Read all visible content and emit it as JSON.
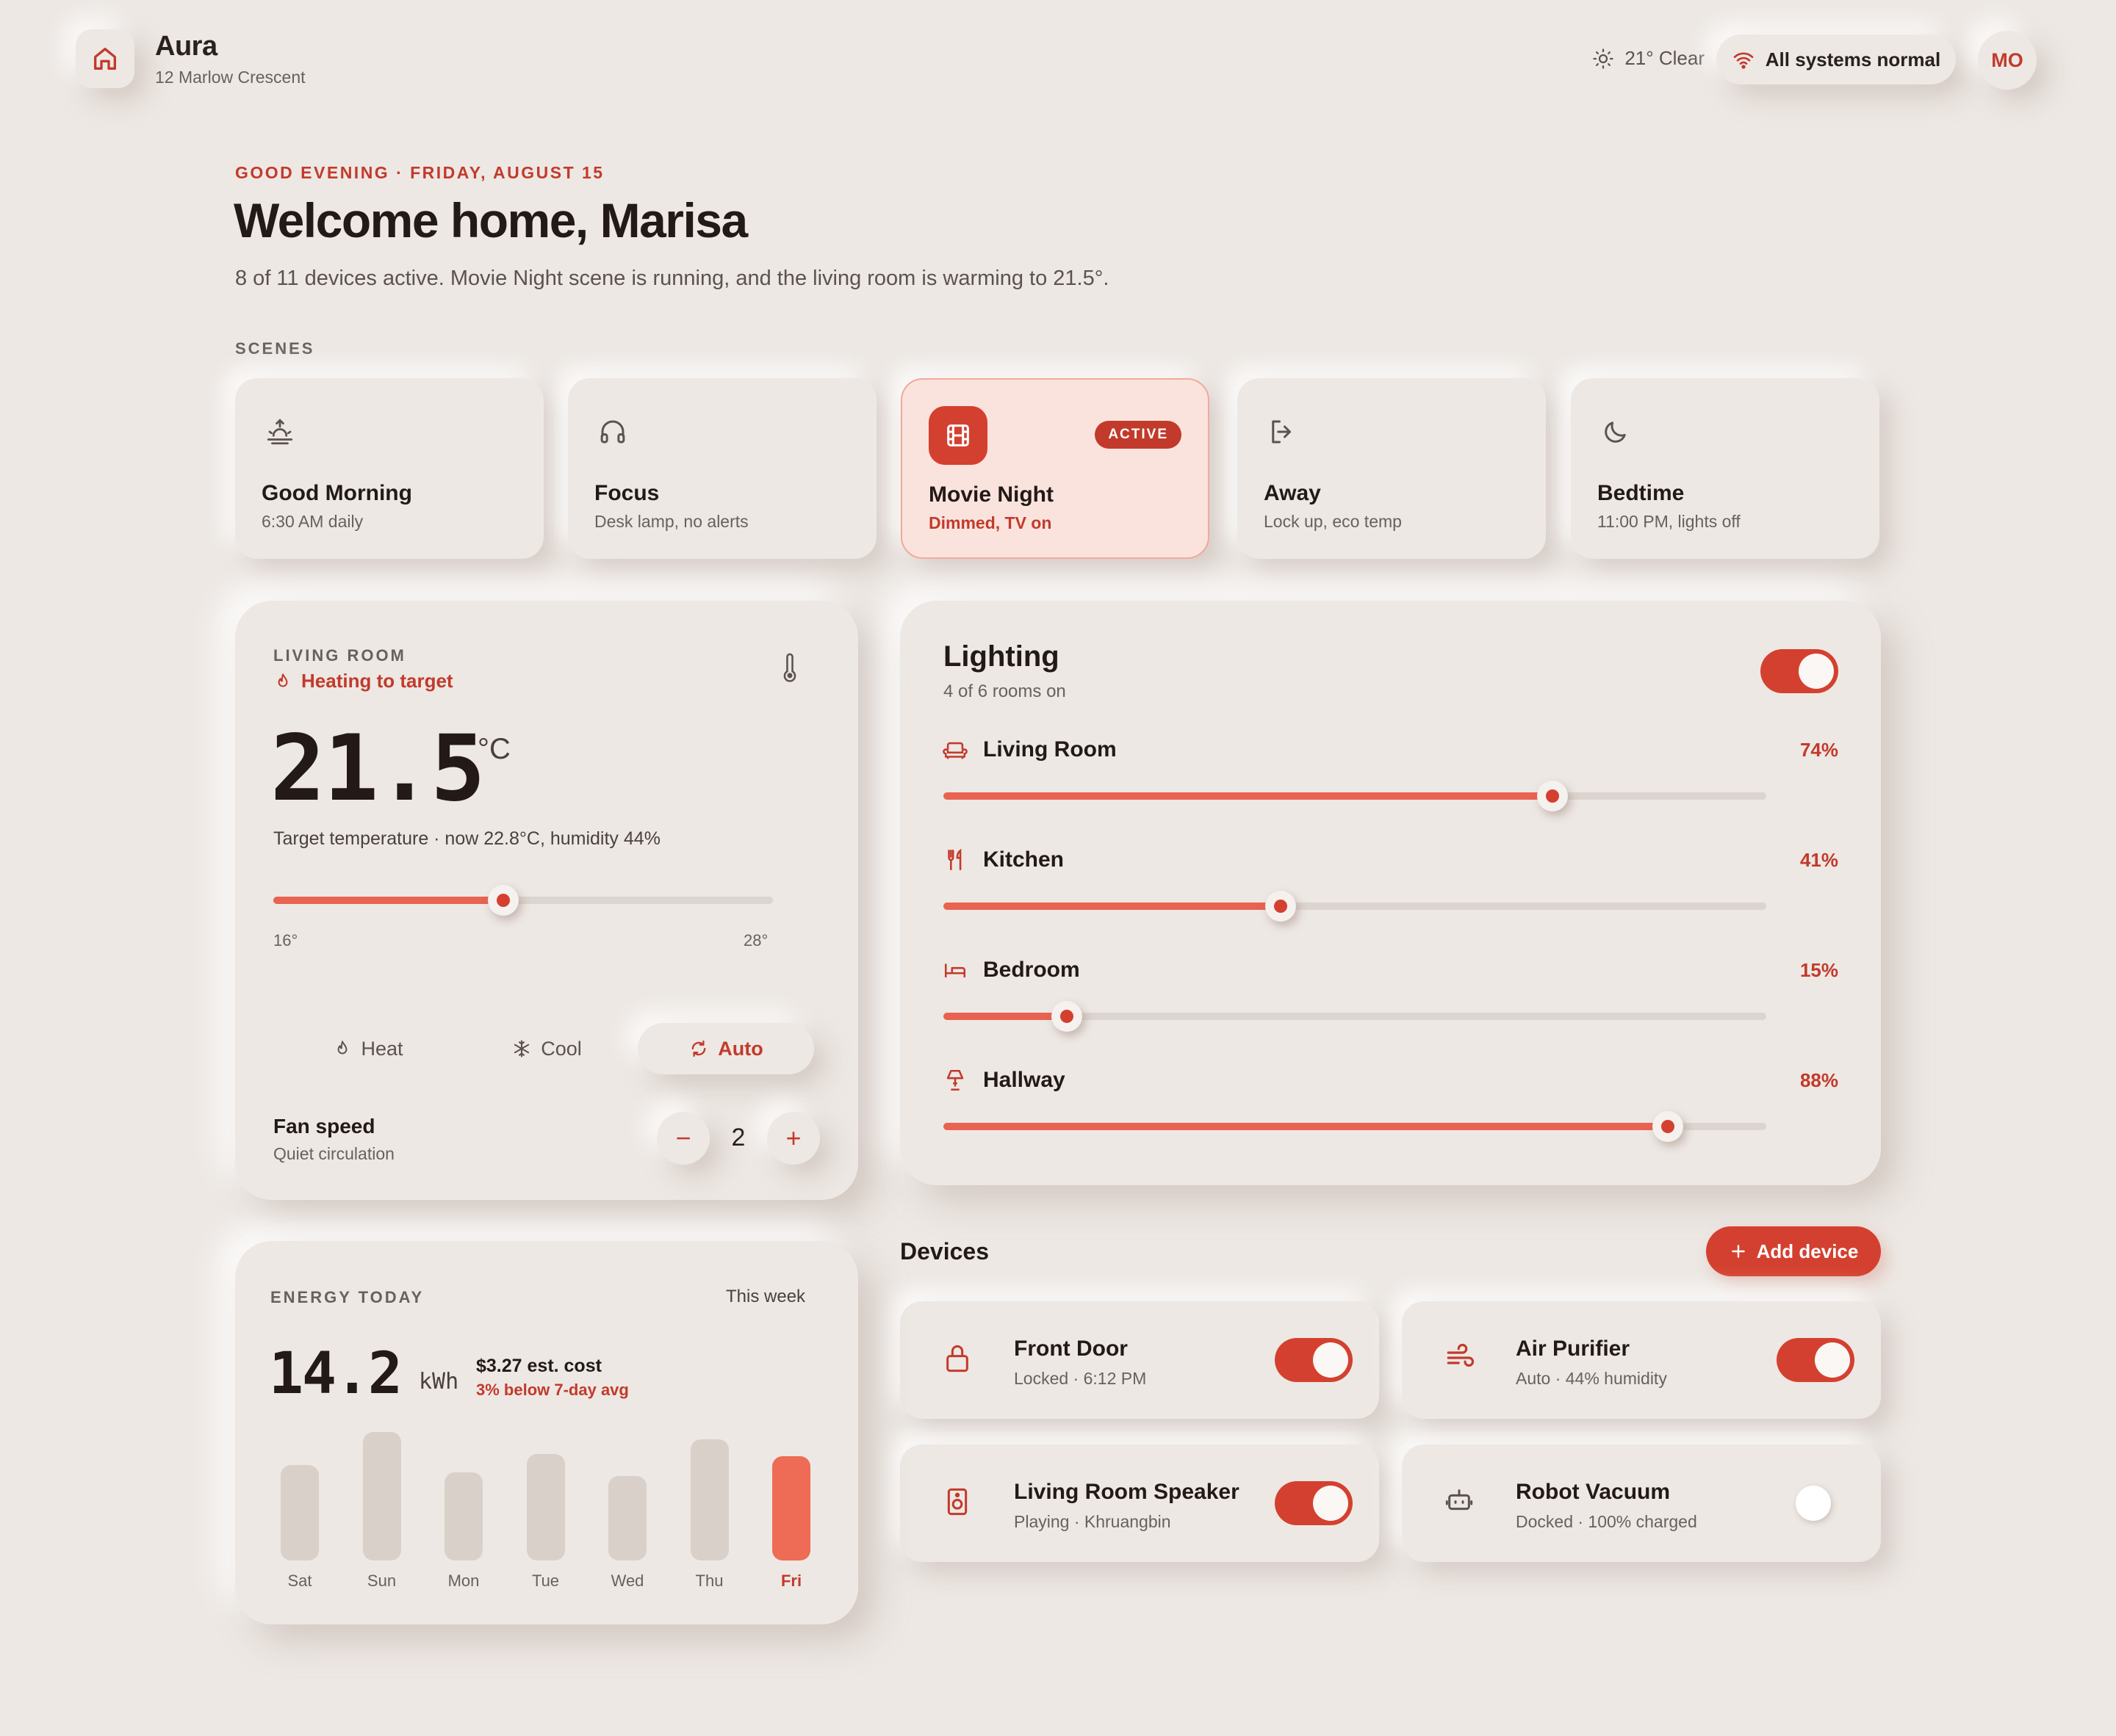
{
  "header": {
    "brand": "Aura",
    "address": "12 Marlow Crescent",
    "weather": "21° Clear",
    "status": "All systems normal",
    "avatar_initials": "MO"
  },
  "hero": {
    "greeting": "GOOD EVENING · FRIDAY, AUGUST 15",
    "title": "Welcome home, Marisa",
    "summary": "8 of 11 devices active. Movie Night scene is running, and the living room is warming to 21.5°."
  },
  "scenes": {
    "label": "SCENES",
    "items": [
      {
        "name": "Good Morning",
        "desc": "6:30 AM daily",
        "icon": "sunrise-icon",
        "active": false
      },
      {
        "name": "Focus",
        "desc": "Desk lamp, no alerts",
        "icon": "headphones-icon",
        "active": false
      },
      {
        "name": "Movie Night",
        "desc": "Dimmed, TV on",
        "icon": "film-icon",
        "active": true,
        "badge": "ACTIVE"
      },
      {
        "name": "Away",
        "desc": "Lock up, eco temp",
        "icon": "logout-icon",
        "active": false
      },
      {
        "name": "Bedtime",
        "desc": "11:00 PM, lights off",
        "icon": "moon-icon",
        "active": false
      }
    ]
  },
  "thermostat": {
    "room": "LIVING ROOM",
    "status": "Heating to target",
    "temp_value": "21.5",
    "temp_unit": "°C",
    "caption": "Target temperature · now 22.8°C, humidity 44%",
    "slider_min": "16°",
    "slider_max": "28°",
    "target_fraction": 0.46,
    "modes": [
      {
        "label": "Heat",
        "icon": "flame-icon",
        "selected": false
      },
      {
        "label": "Cool",
        "icon": "snowflake-icon",
        "selected": false
      },
      {
        "label": "Auto",
        "icon": "refresh-icon",
        "selected": true
      }
    ],
    "fan": {
      "label": "Fan speed",
      "sub": "Quiet circulation",
      "value": "2",
      "minus": "−",
      "plus": "+"
    }
  },
  "lighting": {
    "title": "Lighting",
    "subtitle": "4 of 6 rooms on",
    "master_on": true,
    "rooms": [
      {
        "name": "Living Room",
        "pct": "74%",
        "level": 0.74,
        "icon": "sofa-icon"
      },
      {
        "name": "Kitchen",
        "pct": "41%",
        "level": 0.41,
        "icon": "utensils-icon"
      },
      {
        "name": "Bedroom",
        "pct": "15%",
        "level": 0.15,
        "icon": "bed-icon"
      },
      {
        "name": "Hallway",
        "pct": "88%",
        "level": 0.88,
        "icon": "lamp-icon"
      }
    ]
  },
  "devices": {
    "title": "Devices",
    "add_label": "Add device",
    "items": [
      {
        "name": "Front Door",
        "meta": "Locked · 6:12 PM",
        "icon": "lock-icon",
        "on": true
      },
      {
        "name": "Air Purifier",
        "meta": "Auto · 44% humidity",
        "icon": "wind-icon",
        "on": true
      },
      {
        "name": "Living Room Speaker",
        "meta": "Playing · Khruangbin",
        "icon": "speaker-icon",
        "on": true
      },
      {
        "name": "Robot Vacuum",
        "meta": "Docked · 100% charged",
        "icon": "robot-icon",
        "on": false
      }
    ]
  },
  "energy": {
    "label": "ENERGY TODAY",
    "range": "This week",
    "value": "14.2",
    "unit": "kWh",
    "cost": "$3.27 est. cost",
    "delta": "3% below 7-day avg",
    "chart_data": {
      "type": "bar",
      "categories": [
        "Sat",
        "Sun",
        "Mon",
        "Tue",
        "Wed",
        "Thu",
        "Fri"
      ],
      "values": [
        13,
        17.5,
        12,
        14.5,
        11.5,
        16.5,
        14.2
      ],
      "highlight": "Fri"
    }
  },
  "colors": {
    "accent": "#d4402f",
    "accent_text": "#c23a2b",
    "background": "#ede8e4"
  }
}
